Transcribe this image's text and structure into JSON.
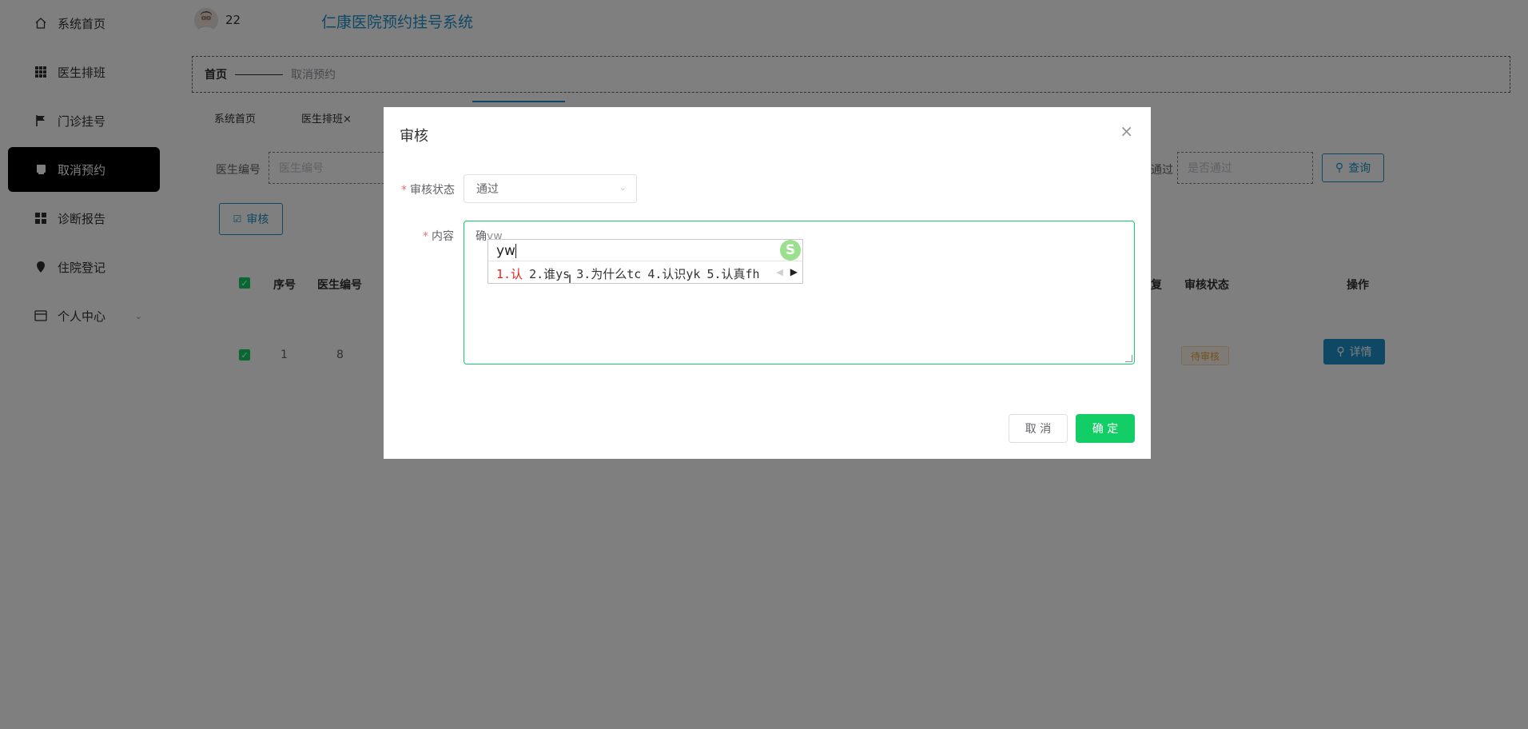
{
  "sidebar": {
    "items": [
      {
        "label": "系统首页",
        "icon": "home-icon"
      },
      {
        "label": "医生排班",
        "icon": "grid-icon"
      },
      {
        "label": "门诊挂号",
        "icon": "flag-icon"
      },
      {
        "label": "取消预约",
        "icon": "document-icon",
        "active": true
      },
      {
        "label": "诊断报告",
        "icon": "apps-icon"
      },
      {
        "label": "住院登记",
        "icon": "location-pin-icon"
      },
      {
        "label": "个人中心",
        "icon": "user-card-icon"
      }
    ]
  },
  "header": {
    "user_name": "22",
    "site_title": "仁康医院预约挂号系统"
  },
  "breadcrumb": {
    "home": "首页",
    "current": "取消预约"
  },
  "tabs": [
    {
      "label": "系统首页"
    },
    {
      "label": "医生排班×"
    }
  ],
  "filters": {
    "doctor_no_label": "医生编号",
    "doctor_no_placeholder": "医生编号",
    "passed_label": "通过",
    "passed_placeholder": "是否通过",
    "query_label": "查询"
  },
  "toolbar": {
    "audit_label": "审核"
  },
  "table": {
    "headers": [
      "序号",
      "医生编号",
      "复",
      "审核状态",
      "操作"
    ],
    "rows": [
      {
        "index": "1",
        "doctor_no": "8",
        "status": "待审核",
        "action": "详情"
      }
    ]
  },
  "dialog": {
    "title": "审核",
    "close_icon": "×",
    "status_label": "审核状态",
    "status_value": "通过",
    "content_label": "内容",
    "content_committed": "确",
    "content_composing": "yw",
    "cancel_label": "取 消",
    "confirm_label": "确 定"
  },
  "ime": {
    "input": "yw",
    "logo": "S",
    "candidates": [
      "1.认",
      "2.谁ys",
      "3.为什么tc",
      "4.认识yk",
      "5.认真fh"
    ]
  },
  "colors": {
    "brand": "#1e90c8",
    "success": "#13ce66",
    "warning": "#e6a23c"
  }
}
